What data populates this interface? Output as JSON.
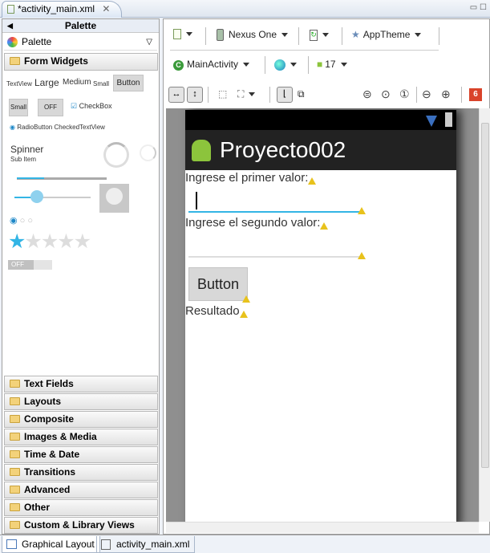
{
  "editor_tab": {
    "title": "*activity_main.xml",
    "close_icon": "close-icon"
  },
  "palette": {
    "header": "Palette",
    "selector": "Palette",
    "open_category": "Form Widgets",
    "widgets": {
      "textview": "TextView",
      "large": "Large",
      "medium": "Medium",
      "small": "Small",
      "button": "Button",
      "small_button": "Small",
      "toggle": "OFF",
      "checkbox": "CheckBox",
      "radio": "RadioButton",
      "checked_textview": "CheckedTextView",
      "spinner": "Spinner",
      "spinner_sub": "Sub Item",
      "rating_stars": 5,
      "rating_value": 1,
      "switch": "OFF"
    },
    "categories": [
      "Text Fields",
      "Layouts",
      "Composite",
      "Images & Media",
      "Time & Date",
      "Transitions",
      "Advanced",
      "Other",
      "Custom & Library Views"
    ]
  },
  "toolbar": {
    "device": "Nexus One",
    "theme": "AppTheme",
    "activity": "MainActivity",
    "api_level": "17",
    "error_count": "6"
  },
  "device_screen": {
    "app_title": "Proyecto002",
    "label1": "Ingrese el primer valor:",
    "label2": "Ingrese el segundo valor:",
    "button": "Button",
    "result": "Resultado",
    "accent_color": "#33b5e5"
  },
  "bottom_tabs": [
    "Graphical Layout",
    "activity_main.xml"
  ]
}
